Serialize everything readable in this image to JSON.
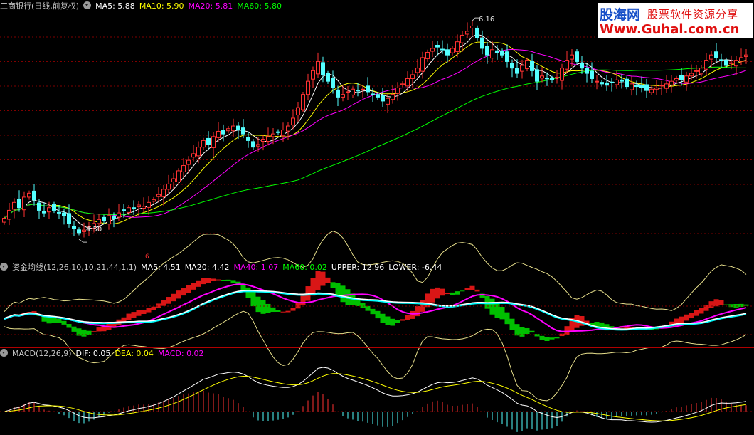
{
  "price_header": {
    "title": "工商银行(日线,前复权)",
    "ma5": "MA5: 5.88",
    "ma10": "MA10: 5.90",
    "ma20": "MA20: 5.81",
    "ma60": "MA60: 5.80"
  },
  "fund_header": {
    "title": "资金均线(12,26,10,10,21,44,1,1)",
    "ma5": "MA5: 4.51",
    "ma20": "MA20: 4.42",
    "ma40": "MA40: 1.07",
    "ma60": "MA60: 0.02",
    "upper": "UPPER: 12.96",
    "lower": "LOWER: -6.44"
  },
  "macd_header": {
    "title": "MACD(12,26,9)",
    "dif": "DIF: 0.05",
    "dea": "DEA: 0.04",
    "macd": "MACD: 0.02"
  },
  "annotations": {
    "high_label": "6.16",
    "low_label": "4.50",
    "marker": "6"
  },
  "watermark": {
    "brand": "股海网",
    "slogan": "股票软件资源分享",
    "url": "Www.Guhai.com.cn"
  },
  "colors": {
    "up": "#ff3232",
    "down": "#54ffff",
    "ma5": "#ffffff",
    "ma10": "#ffff00",
    "ma20": "#ff00ff",
    "ma60": "#00ff00",
    "grid": "#800000",
    "divider": "#b00000"
  },
  "chart_data": [
    {
      "type": "candlestick",
      "title": "工商银行(日线,前复权)",
      "ylim": [
        4.36,
        6.22
      ],
      "x_count": 150,
      "high_marker": {
        "index": 94,
        "value": 6.16
      },
      "low_marker": {
        "index": 15,
        "value": 4.5
      },
      "close": [
        4.66,
        4.72,
        4.78,
        4.74,
        4.82,
        4.85,
        4.8,
        4.72,
        4.7,
        4.74,
        4.72,
        4.7,
        4.68,
        4.62,
        4.58,
        4.55,
        4.57,
        4.6,
        4.62,
        4.65,
        4.64,
        4.68,
        4.66,
        4.7,
        4.72,
        4.74,
        4.73,
        4.76,
        4.75,
        4.78,
        4.8,
        4.84,
        4.88,
        4.92,
        4.96,
        5.02,
        5.06,
        5.1,
        5.15,
        5.2,
        5.25,
        5.22,
        5.28,
        5.32,
        5.3,
        5.34,
        5.36,
        5.33,
        5.3,
        5.25,
        5.2,
        5.22,
        5.26,
        5.28,
        5.3,
        5.31,
        5.33,
        5.36,
        5.42,
        5.5,
        5.6,
        5.7,
        5.78,
        5.85,
        5.75,
        5.7,
        5.65,
        5.58,
        5.6,
        5.62,
        5.64,
        5.63,
        5.64,
        5.62,
        5.6,
        5.58,
        5.55,
        5.57,
        5.6,
        5.65,
        5.68,
        5.72,
        5.75,
        5.8,
        5.88,
        5.92,
        5.95,
        5.96,
        5.94,
        5.9,
        5.95,
        6.0,
        6.05,
        6.08,
        6.12,
        6.03,
        5.95,
        5.9,
        5.94,
        5.92,
        5.9,
        5.85,
        5.8,
        5.76,
        5.82,
        5.86,
        5.78,
        5.7,
        5.74,
        5.72,
        5.71,
        5.73,
        5.8,
        5.86,
        5.9,
        5.85,
        5.8,
        5.76,
        5.72,
        5.7,
        5.68,
        5.67,
        5.69,
        5.71,
        5.7,
        5.66,
        5.68,
        5.66,
        5.65,
        5.63,
        5.64,
        5.65,
        5.67,
        5.68,
        5.7,
        5.72,
        5.71,
        5.74,
        5.76,
        5.78,
        5.8,
        5.86,
        5.9,
        5.88,
        5.86,
        5.82,
        5.84,
        5.86,
        5.88,
        5.9
      ]
    },
    {
      "type": "line",
      "title": "资金均线(12,26,10,10,21,44,1,1)",
      "ylim": [
        -8.5,
        15.0
      ],
      "last_values": {
        "MA5": 4.51,
        "MA20": 4.42,
        "MA40": 1.07,
        "MA60": 0.02,
        "UPPER": 12.96,
        "LOWER": -6.44
      }
    },
    {
      "type": "bar",
      "title": "MACD(12,26,9)",
      "last_values": {
        "DIF": 0.05,
        "DEA": 0.04,
        "MACD": 0.02
      }
    }
  ]
}
